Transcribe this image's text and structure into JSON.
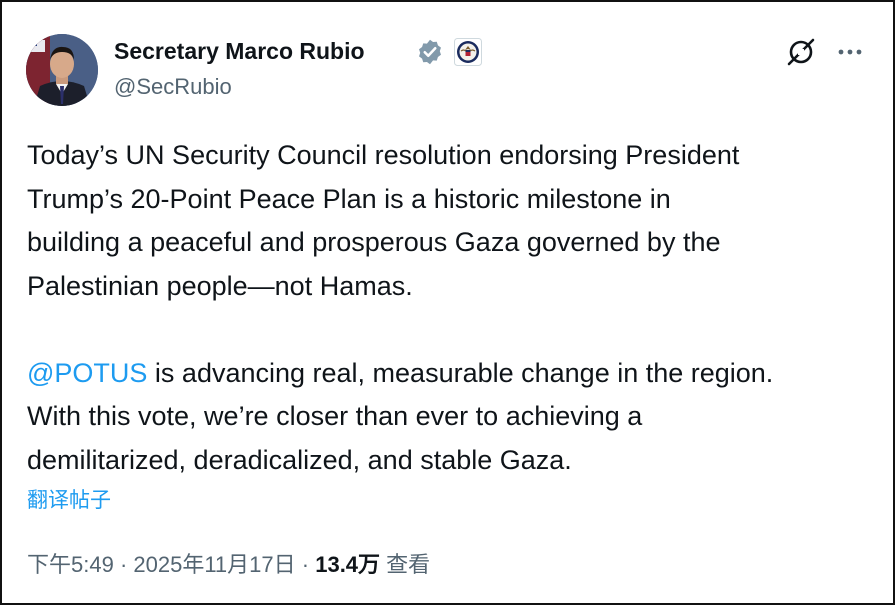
{
  "author": {
    "display_name": "Secretary Marco Rubio",
    "handle": "@SecRubio",
    "avatar_icon": "avatar-photo-icon",
    "verified_icon": "verified-badge-icon",
    "affiliation_icon": "state-department-seal-icon",
    "verified_color": "#829aab"
  },
  "header_actions": {
    "grok_icon": "grok-icon",
    "more_icon": "more-options-icon"
  },
  "post": {
    "paragraph1": {
      "line1": "Today’s UN Security Council resolution endorsing President",
      "line2": "Trump’s 20-Point Peace Plan is a historic milestone in",
      "line3": "building a peaceful and prosperous Gaza governed by the",
      "line4": "Palestinian people—not Hamas."
    },
    "paragraph2": {
      "mention": "@POTUS",
      "line1_rest": " is advancing real, measurable change in the region.",
      "line2": "With this vote, we’re closer than ever to achieving a",
      "line3": "demilitarized, deradicalized, and stable Gaza."
    },
    "translate_label": "翻译帖子"
  },
  "meta": {
    "time": "下午5:49",
    "separator": " · ",
    "date": "2025年11月17日",
    "views_count": "13.4万",
    "views_label": " 查看"
  },
  "colors": {
    "text": "#0f1419",
    "secondary": "#536471",
    "link": "#1d9bf0"
  }
}
